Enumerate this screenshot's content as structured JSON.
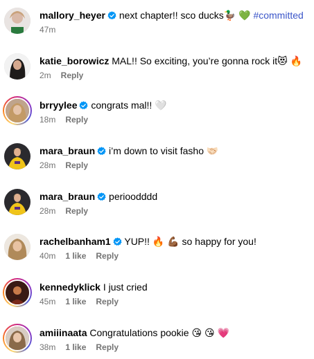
{
  "comments": [
    {
      "username": "mallory_heyer",
      "verified": true,
      "text": "next chapter!! sco ducks🦆 💚",
      "hashtag": " #committed",
      "time": "47m",
      "likes": "",
      "reply": ""
    },
    {
      "username": "katie_borowicz",
      "verified": false,
      "text": "MAL!! So exciting, you’re gonna rock it😻 🔥",
      "hashtag": "",
      "time": "2m",
      "likes": "",
      "reply": "Reply"
    },
    {
      "username": "brryylee",
      "verified": true,
      "text": "congrats mal!! 🤍",
      "hashtag": "",
      "time": "18m",
      "likes": "",
      "reply": "Reply"
    },
    {
      "username": "mara_braun",
      "verified": true,
      "text": "i’m down to visit fasho 🤝🏻",
      "hashtag": "",
      "time": "28m",
      "likes": "",
      "reply": "Reply"
    },
    {
      "username": "mara_braun",
      "verified": true,
      "text": "perioodddd",
      "hashtag": "",
      "time": "28m",
      "likes": "",
      "reply": "Reply"
    },
    {
      "username": "rachelbanham1",
      "verified": true,
      "text": "YUP!! 🔥 💪🏾 so happy for you!",
      "hashtag": "",
      "time": "40m",
      "likes": "1 like",
      "reply": "Reply"
    },
    {
      "username": "kennedyklick",
      "verified": false,
      "text": "I just cried",
      "hashtag": "",
      "time": "45m",
      "likes": "1 like",
      "reply": "Reply"
    },
    {
      "username": "amiiinaata",
      "verified": false,
      "text": "Congratulations pookie 😘 😘 💗",
      "hashtag": "",
      "time": "38m",
      "likes": "1 like",
      "reply": "Reply"
    }
  ],
  "colors": {
    "verified": "#0095f6",
    "hashtag": "#3b56c9",
    "meta": "#737373"
  }
}
